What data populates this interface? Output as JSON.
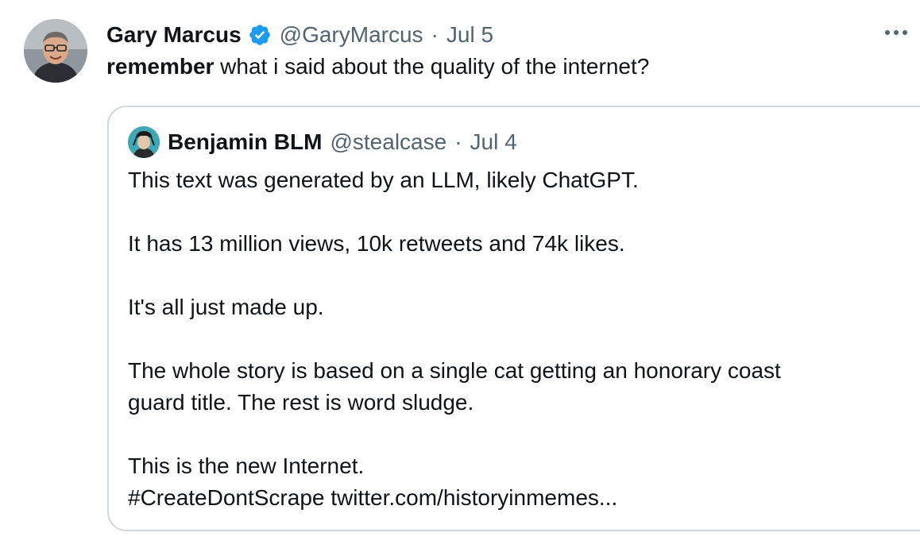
{
  "tweet": {
    "author_name": "Gary Marcus",
    "handle": "@GaryMarcus",
    "separator": "·",
    "date": "Jul 5",
    "text_bold": "remember",
    "text_rest": " what i said about the quality of the internet?"
  },
  "quoted": {
    "author_name": "Benjamin BLM",
    "handle": "@stealcase",
    "separator": "·",
    "date": "Jul 4",
    "lines": [
      "This text was generated by an LLM, likely ChatGPT.",
      "It has 13 million views, 10k retweets and 74k likes.",
      "It's all just made up.",
      "The whole story is based on a single cat getting an honorary coast",
      "guard title. The rest is word sludge.",
      "This is the new Internet.",
      "#CreateDontScrape twitter.com/historyinmemes..."
    ]
  },
  "colors": {
    "verified": "#1d9bf0",
    "secondary_text": "#536471",
    "border": "#cfd9de"
  },
  "icons": {
    "verified": "verified-badge-icon",
    "more": "more-horizontal-icon"
  }
}
